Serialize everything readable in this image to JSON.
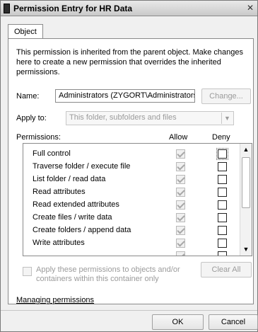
{
  "window": {
    "title": "Permission Entry for HR Data"
  },
  "tabs": [
    {
      "label": "Object"
    }
  ],
  "description": "This permission is inherited from the parent object. Make changes here to create a new permission that overrides the inherited permissions.",
  "name_field": {
    "label": "Name:",
    "value": "Administrators (ZYGORT\\Administrators",
    "change_button": "Change..."
  },
  "apply_to": {
    "label": "Apply to:",
    "value": "This folder, subfolders and files"
  },
  "permissions": {
    "header": "Permissions:",
    "allow_header": "Allow",
    "deny_header": "Deny",
    "items": [
      {
        "name": "Full control",
        "allow": true,
        "deny": false
      },
      {
        "name": "Traverse folder / execute file",
        "allow": true,
        "deny": false
      },
      {
        "name": "List folder / read data",
        "allow": true,
        "deny": false
      },
      {
        "name": "Read attributes",
        "allow": true,
        "deny": false
      },
      {
        "name": "Read extended attributes",
        "allow": true,
        "deny": false
      },
      {
        "name": "Create files / write data",
        "allow": true,
        "deny": false
      },
      {
        "name": "Create folders / append data",
        "allow": true,
        "deny": false
      },
      {
        "name": "Write attributes",
        "allow": true,
        "deny": false
      }
    ]
  },
  "inherit_checkbox": {
    "label": "Apply these permissions to objects and/or containers within this container only",
    "checked": false
  },
  "clear_all_button": "Clear All",
  "managing_link": "Managing permissions",
  "ok_button": "OK",
  "cancel_button": "Cancel"
}
